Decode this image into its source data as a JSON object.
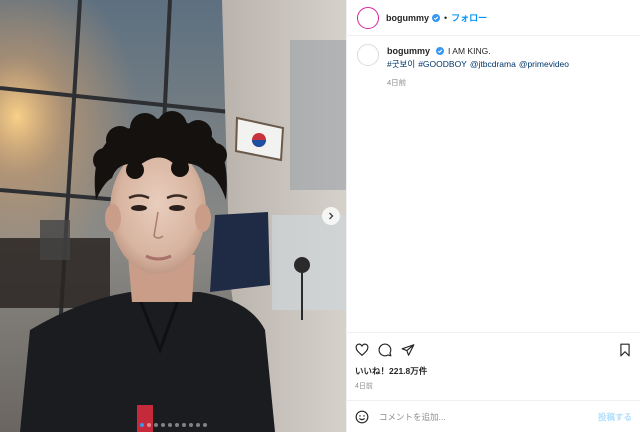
{
  "header": {
    "username": "bogummy",
    "separator": "•",
    "follow_label": "フォロー",
    "more_label": "···"
  },
  "caption": {
    "username": "bogummy",
    "text": "I AM KING.",
    "tags": [
      "#굿보이",
      "#GOODBOY",
      "@jtbcdrama",
      "@primevideo"
    ],
    "time": "4日前"
  },
  "actions": {
    "likes": "いいね！221.8万件",
    "time": "4日前"
  },
  "comment": {
    "placeholder": "コメントを追加...",
    "post_label": "投稿する"
  },
  "carousel": {
    "dot_count": 10,
    "active_index": 0
  },
  "colors": {
    "accent": "#0095f6",
    "verified": "#3897f0",
    "hashtag": "#00376b",
    "muted": "#8e8e8e",
    "post_disabled": "#b2dffc"
  },
  "icons": [
    "chevron-right-icon",
    "verified-badge-icon",
    "heart-icon",
    "comment-icon",
    "share-icon",
    "bookmark-icon",
    "emoji-icon"
  ]
}
